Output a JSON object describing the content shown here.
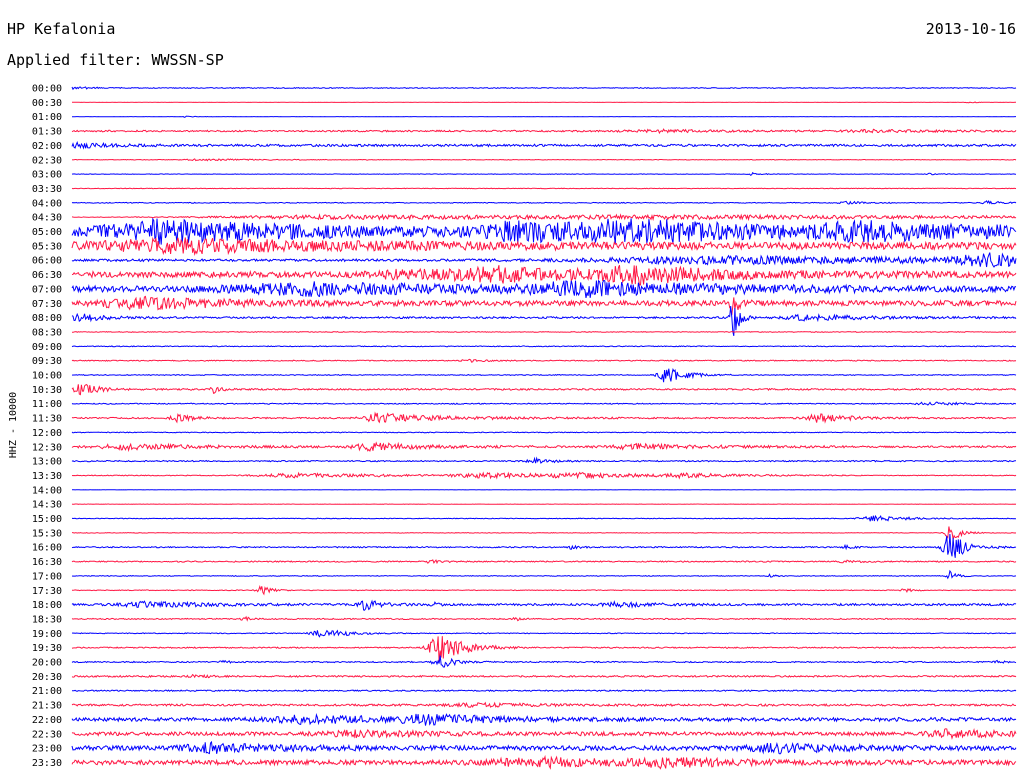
{
  "header": {
    "station": "HP Kefalonia",
    "date": "2013-10-16",
    "filter_label": "Applied filter: WWSSN-SP"
  },
  "chart_data": {
    "type": "line",
    "title": "HP Kefalonia",
    "ylabel": "HHZ - 10000",
    "colors": {
      "blue": "#0000ff",
      "red": "#ff1744"
    },
    "color_cycle": [
      "blue",
      "red"
    ],
    "rows": [
      {
        "time": "00:00",
        "base": 0.4,
        "events": [
          [
            0.0,
            1.6,
            0.012
          ]
        ]
      },
      {
        "time": "00:30",
        "base": 0.1,
        "events": [
          [
            0.95,
            0.6,
            0.005
          ]
        ]
      },
      {
        "time": "01:00",
        "base": 0.15,
        "events": [
          [
            0.12,
            0.6,
            0.005
          ]
        ]
      },
      {
        "time": "01:30",
        "base": 0.8,
        "events": [
          [
            0.62,
            1.2,
            0.04
          ],
          [
            0.85,
            1.0,
            0.04
          ]
        ]
      },
      {
        "time": "02:00",
        "base": 1.1,
        "events": [
          [
            0.01,
            2.2,
            0.02
          ]
        ]
      },
      {
        "time": "02:30",
        "base": 0.3,
        "events": [
          [
            0.14,
            0.8,
            0.03
          ]
        ]
      },
      {
        "time": "03:00",
        "base": 0.25,
        "events": [
          [
            0.72,
            1.5,
            0.005
          ],
          [
            0.91,
            0.8,
            0.005
          ]
        ]
      },
      {
        "time": "03:30",
        "base": 0.25,
        "events": []
      },
      {
        "time": "04:00",
        "base": 0.4,
        "events": [
          [
            0.82,
            1.5,
            0.01
          ],
          [
            0.97,
            1.6,
            0.01
          ]
        ]
      },
      {
        "time": "04:30",
        "base": 0.2,
        "events": [
          [
            0.7,
            1.5,
            0.3
          ],
          [
            0.3,
            2.2,
            0.2
          ]
        ]
      },
      {
        "time": "05:00",
        "base": 4.5,
        "events": [
          [
            0.1,
            9.0,
            0.08
          ],
          [
            0.48,
            7.5,
            0.06
          ],
          [
            0.6,
            8.5,
            0.06
          ],
          [
            0.85,
            6.0,
            0.1
          ]
        ]
      },
      {
        "time": "05:30",
        "base": 3.5,
        "events": [
          [
            0.12,
            5.0,
            0.12
          ]
        ]
      },
      {
        "time": "06:00",
        "base": 1.2,
        "events": [
          [
            0.7,
            3.5,
            0.2
          ],
          [
            0.97,
            5.0,
            0.04
          ]
        ]
      },
      {
        "time": "06:30",
        "base": 3.0,
        "events": [
          [
            0.45,
            5.5,
            0.05
          ],
          [
            0.6,
            6.5,
            0.06
          ],
          [
            0.36,
            3.5,
            0.05
          ]
        ]
      },
      {
        "time": "07:00",
        "base": 3.0,
        "events": [
          [
            0.25,
            5.0,
            0.1
          ],
          [
            0.55,
            5.5,
            0.08
          ]
        ]
      },
      {
        "time": "07:30",
        "base": 2.6,
        "events": [
          [
            0.07,
            5.0,
            0.05
          ],
          [
            0.7,
            12.0,
            0.004
          ]
        ]
      },
      {
        "time": "08:00",
        "base": 0.9,
        "events": [
          [
            0.01,
            3.5,
            0.015
          ],
          [
            0.78,
            2.5,
            0.04
          ],
          [
            0.7,
            22.0,
            0.004
          ]
        ]
      },
      {
        "time": "08:30",
        "base": 0.35,
        "events": []
      },
      {
        "time": "09:00",
        "base": 0.4,
        "events": []
      },
      {
        "time": "09:30",
        "base": 0.5,
        "events": [
          [
            0.42,
            1.2,
            0.01
          ]
        ]
      },
      {
        "time": "10:00",
        "base": 0.4,
        "events": [
          [
            0.63,
            8.0,
            0.012
          ]
        ]
      },
      {
        "time": "10:30",
        "base": 0.8,
        "events": [
          [
            0.01,
            6.0,
            0.01
          ],
          [
            0.15,
            4.0,
            0.004
          ]
        ]
      },
      {
        "time": "11:00",
        "base": 0.5,
        "events": [
          [
            0.91,
            1.5,
            0.02
          ]
        ]
      },
      {
        "time": "11:30",
        "base": 0.7,
        "events": [
          [
            0.11,
            4.0,
            0.01
          ],
          [
            0.32,
            4.5,
            0.01
          ],
          [
            0.35,
            2.5,
            0.05
          ],
          [
            0.79,
            4.0,
            0.02
          ]
        ]
      },
      {
        "time": "12:00",
        "base": 0.4,
        "events": []
      },
      {
        "time": "12:30",
        "base": 1.0,
        "events": [
          [
            0.32,
            3.5,
            0.03
          ],
          [
            0.06,
            2.5,
            0.04
          ],
          [
            0.6,
            2.5,
            0.04
          ]
        ]
      },
      {
        "time": "13:00",
        "base": 0.6,
        "events": [
          [
            0.49,
            3.0,
            0.01
          ]
        ]
      },
      {
        "time": "13:30",
        "base": 0.4,
        "events": [
          [
            0.24,
            2.0,
            0.06
          ],
          [
            0.44,
            2.0,
            0.05
          ],
          [
            0.54,
            2.0,
            0.05
          ],
          [
            0.65,
            1.8,
            0.03
          ]
        ]
      },
      {
        "time": "14:00",
        "base": 0.15,
        "events": []
      },
      {
        "time": "14:30",
        "base": 0.15,
        "events": []
      },
      {
        "time": "15:00",
        "base": 0.3,
        "events": [
          [
            0.85,
            3.0,
            0.02
          ]
        ]
      },
      {
        "time": "15:30",
        "base": 0.3,
        "events": [
          [
            0.93,
            10.0,
            0.006
          ]
        ]
      },
      {
        "time": "16:00",
        "base": 0.6,
        "events": [
          [
            0.53,
            3.0,
            0.004
          ],
          [
            0.93,
            14.0,
            0.01
          ],
          [
            0.82,
            1.5,
            0.005
          ]
        ]
      },
      {
        "time": "16:30",
        "base": 0.6,
        "events": [
          [
            0.38,
            1.2,
            0.01
          ],
          [
            0.82,
            1.2,
            0.01
          ]
        ]
      },
      {
        "time": "17:00",
        "base": 0.35,
        "events": [
          [
            0.74,
            1.5,
            0.004
          ],
          [
            0.93,
            8.0,
            0.004
          ]
        ]
      },
      {
        "time": "17:30",
        "base": 0.35,
        "events": [
          [
            0.2,
            5.0,
            0.006
          ],
          [
            0.88,
            3.0,
            0.004
          ]
        ]
      },
      {
        "time": "18:00",
        "base": 1.0,
        "events": [
          [
            0.31,
            5.0,
            0.01
          ],
          [
            0.08,
            2.5,
            0.04
          ],
          [
            0.58,
            2.5,
            0.02
          ],
          [
            0.38,
            3.0,
            0.004
          ]
        ]
      },
      {
        "time": "18:30",
        "base": 0.6,
        "events": [
          [
            0.18,
            3.0,
            0.004
          ],
          [
            0.47,
            1.5,
            0.004
          ]
        ]
      },
      {
        "time": "19:00",
        "base": 0.4,
        "events": [
          [
            0.26,
            4.5,
            0.01
          ],
          [
            0.28,
            2.0,
            0.015
          ]
        ]
      },
      {
        "time": "19:30",
        "base": 0.6,
        "events": [
          [
            0.39,
            14.0,
            0.015
          ]
        ]
      },
      {
        "time": "20:00",
        "base": 0.6,
        "events": [
          [
            0.39,
            6.0,
            0.01
          ],
          [
            0.16,
            1.5,
            0.004
          ],
          [
            0.98,
            1.5,
            0.004
          ]
        ]
      },
      {
        "time": "20:30",
        "base": 0.8,
        "events": [
          [
            0.13,
            2.0,
            0.006
          ]
        ]
      },
      {
        "time": "21:00",
        "base": 0.6,
        "events": []
      },
      {
        "time": "21:30",
        "base": 1.0,
        "events": [
          [
            0.43,
            1.5,
            0.04
          ]
        ]
      },
      {
        "time": "22:00",
        "base": 1.8,
        "events": [
          [
            0.25,
            3.5,
            0.05
          ],
          [
            0.38,
            4.0,
            0.04
          ]
        ]
      },
      {
        "time": "22:30",
        "base": 1.8,
        "events": [
          [
            0.93,
            3.5,
            0.03
          ],
          [
            0.3,
            2.5,
            0.05
          ]
        ]
      },
      {
        "time": "23:00",
        "base": 2.3,
        "events": [
          [
            0.15,
            4.0,
            0.04
          ],
          [
            0.75,
            3.5,
            0.04
          ]
        ]
      },
      {
        "time": "23:30",
        "base": 2.3,
        "events": [
          [
            0.5,
            3.5,
            0.08
          ],
          [
            0.63,
            3.0,
            0.03
          ]
        ]
      }
    ]
  }
}
